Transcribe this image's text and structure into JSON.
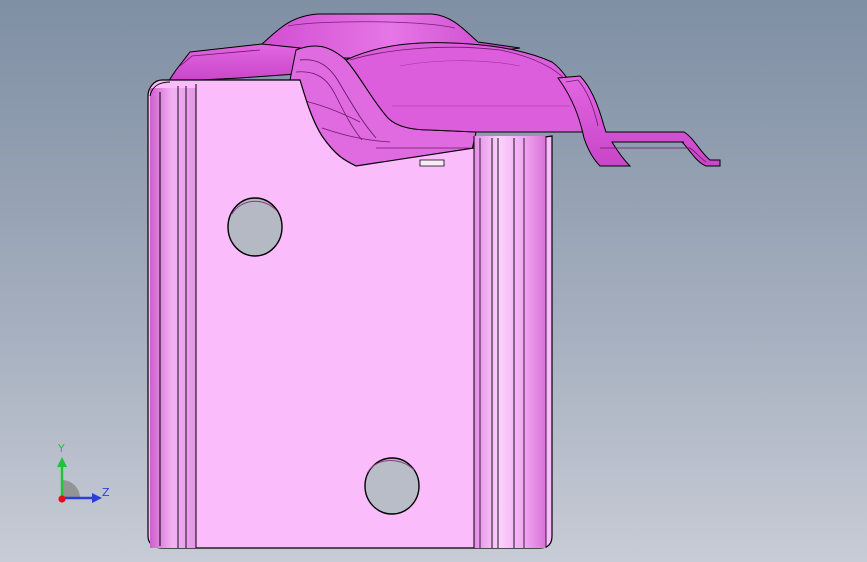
{
  "viewport": {
    "background_top": "#7f8fa4",
    "background_bottom": "#c8ccd6"
  },
  "model": {
    "part_color": "#fbbcfb",
    "edge_color": "#000000",
    "flange_color": "#d85ad8",
    "hole_color": "#b4b9c4"
  },
  "triad": {
    "y_label": "Y",
    "z_label": "Z",
    "y_color": "#1fc23a",
    "z_color": "#2b3fd6",
    "x_color": "#e0101a",
    "cone_color": "#8c8c8c"
  }
}
